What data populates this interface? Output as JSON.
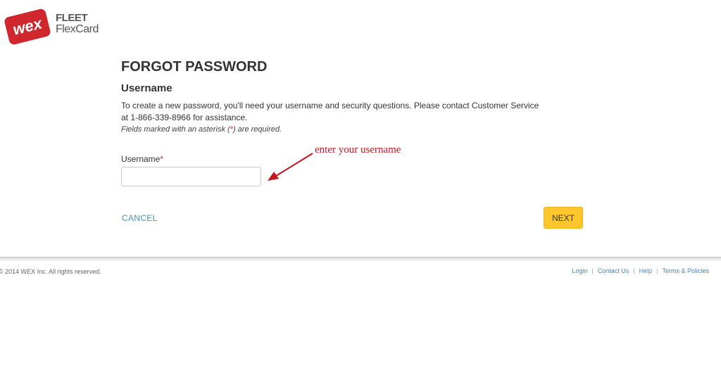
{
  "header": {
    "logo_mark": "wex",
    "logo_line1": "FLEET",
    "logo_line2": "FlexCard",
    "brand_color": "#d0262e"
  },
  "form": {
    "title": "FORGOT PASSWORD",
    "section_title": "Username",
    "intro": "To create a new password, you'll need your username and security questions. Please contact Customer Service at 1-866-339-8966 for assistance.",
    "required_note_prefix": "Fields marked with an asterisk (",
    "required_note_mark": "*",
    "required_note_suffix": ") are required.",
    "username_label": "Username",
    "username_required_mark": "*",
    "username_value": "",
    "cancel_label": "CANCEL",
    "next_label": "NEXT",
    "next_color": "#ffc72c",
    "link_color": "#4a90c2"
  },
  "annotation": {
    "text": "enter your username",
    "color": "#c4161c",
    "icon": "arrow-icon"
  },
  "footer": {
    "copyright": "© 2014 WEX Inc. All rights reserved.",
    "links": [
      "Login",
      "Contact Us",
      "Help",
      "Terms & Policies"
    ],
    "separator": "|"
  }
}
